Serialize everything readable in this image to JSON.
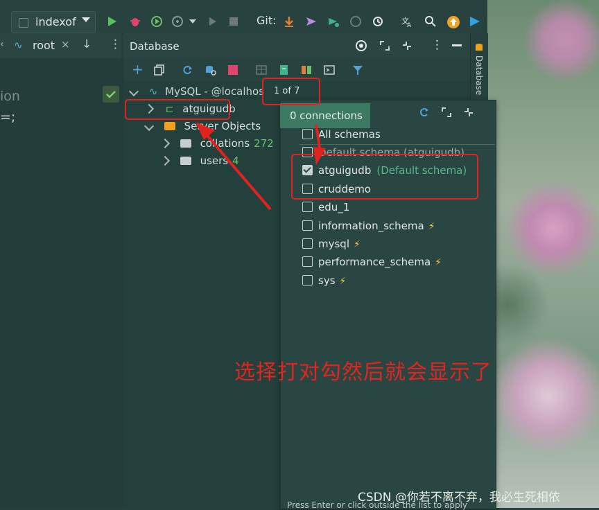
{
  "toolbar": {
    "branch": "indexof",
    "git_label": "Git:"
  },
  "left_panel": {
    "tab_label": "root",
    "code_fragment_1": "ion",
    "code_fragment_2": "=;"
  },
  "database": {
    "title": "Database",
    "tree": {
      "connection": "MySQL - @localhos",
      "schema_counter": "1 of 7",
      "schema_node": "atguigudb",
      "server_objects": "Server Objects",
      "collations_label": "collations",
      "collations_count": "272",
      "users_label": "users",
      "users_count": "4"
    },
    "vertical_tab": "Database"
  },
  "popup": {
    "connections_label": "0 connections",
    "items": [
      {
        "label": "All schemas",
        "checked": false
      },
      {
        "label": "Default schema (atguigudb)",
        "checked": false
      },
      {
        "label": "atguigudb",
        "checked": true,
        "note": "(Default schema)"
      },
      {
        "label": "cruddemo",
        "checked": false
      },
      {
        "label": "edu_1",
        "checked": false
      },
      {
        "label": "information_schema",
        "checked": false,
        "bolt": true
      },
      {
        "label": "mysql",
        "checked": false,
        "bolt": true
      },
      {
        "label": "performance_schema",
        "checked": false,
        "bolt": true
      },
      {
        "label": "sys",
        "checked": false,
        "bolt": true
      }
    ],
    "hint": "Press Enter or click outside the list to apply"
  },
  "annotation": {
    "text": "选择打对勾然后就会显示了"
  },
  "watermark": "CSDN @你若不离不弃，我必生死相依",
  "colors": {
    "annotation_red": "#e0231f",
    "connections_badge": "#3d7a63",
    "default_schema_note": "#58b88a",
    "count_green": "#6fbf6a",
    "bolt": "#f0c24a"
  }
}
